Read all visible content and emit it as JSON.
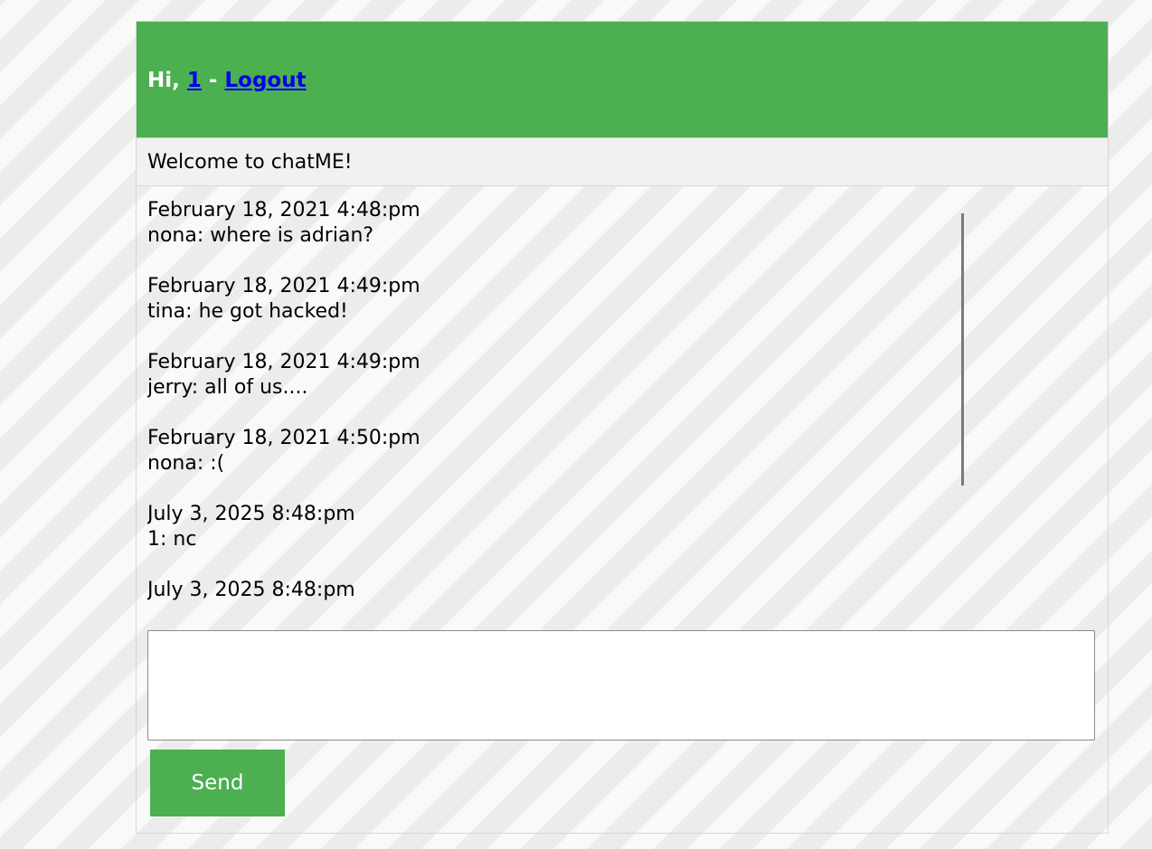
{
  "header": {
    "greeting_prefix": "Hi,",
    "username": "1",
    "separator": "-",
    "logout_label": "Logout"
  },
  "welcome": {
    "text": "Welcome to chatME!"
  },
  "messages": [
    {
      "timestamp": "February 18, 2021 4:48:pm",
      "text": "nona: where is adrian?"
    },
    {
      "timestamp": "February 18, 2021 4:49:pm",
      "text": "tina: he got hacked!"
    },
    {
      "timestamp": "February 18, 2021 4:49:pm",
      "text": "jerry: all of us...."
    },
    {
      "timestamp": "February 18, 2021 4:50:pm",
      "text": "nona: :("
    },
    {
      "timestamp": "July 3, 2025 8:48:pm",
      "text": "1: nc"
    },
    {
      "timestamp": "July 3, 2025 8:48:pm",
      "text": ""
    }
  ],
  "composer": {
    "input_value": "",
    "send_label": "Send"
  },
  "colors": {
    "header_bg": "#4caf50",
    "button_bg": "#4caf50",
    "link": "#0000ee"
  }
}
